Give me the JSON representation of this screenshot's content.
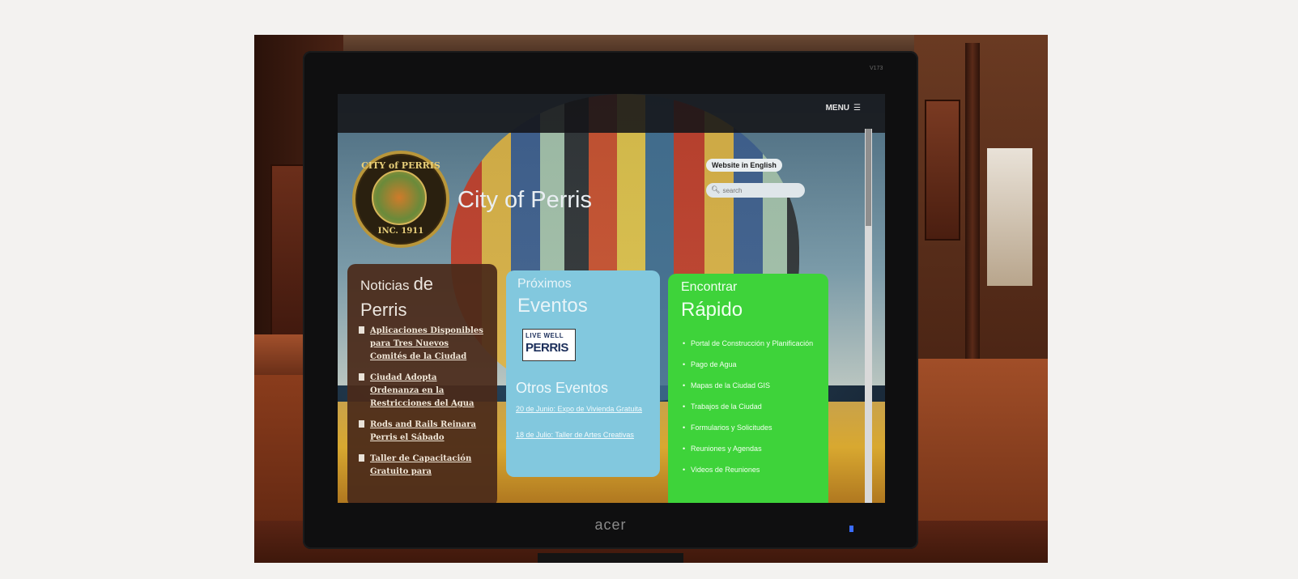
{
  "monitor": {
    "brand": "acer",
    "model": "V173"
  },
  "website": {
    "menu_label": "MENU",
    "menu_icon": "hamburger-icon",
    "title": "City of Perris",
    "seal": {
      "top_text": "CITY of PERRIS",
      "bottom_text": "INC. 1911"
    },
    "language_button": "Website in English",
    "search": {
      "placeholder": "search",
      "icon": "search-icon"
    }
  },
  "news": {
    "title_part1": "Noticias",
    "title_part2": "de",
    "title_part3": "Perris",
    "items": [
      "Aplicaciones Disponibles para Tres Nuevos Comités de la Ciudad",
      "Ciudad Adopta Ordenanza en la Restricciones del Agua",
      "Rods and Rails Reinara Perris el Sábado",
      "Taller de Capacitación Gratuito para"
    ],
    "color": "#4a2a1a"
  },
  "events": {
    "title_small": "Próximos",
    "title_big": "Eventos",
    "logo": {
      "top": "LIVE WELL",
      "main": "PERRIS"
    },
    "other_title": "Otros Eventos",
    "items": [
      "20 de Junio: Expo de Vivienda Gratuita",
      "18 de Julio: Taller de Artes Creativas"
    ],
    "color": "#82c8de"
  },
  "quick": {
    "title_small": "Encontrar",
    "title_big": "Rápido",
    "items": [
      "Portal de Construcción y Planificación",
      "Pago de Agua",
      "Mapas de la Ciudad GIS",
      "Trabajos de la Ciudad",
      "Formularios y Solicitudes",
      "Reuniones y Agendas",
      "Videos de Reuniones"
    ],
    "color": "#3ed33a"
  }
}
